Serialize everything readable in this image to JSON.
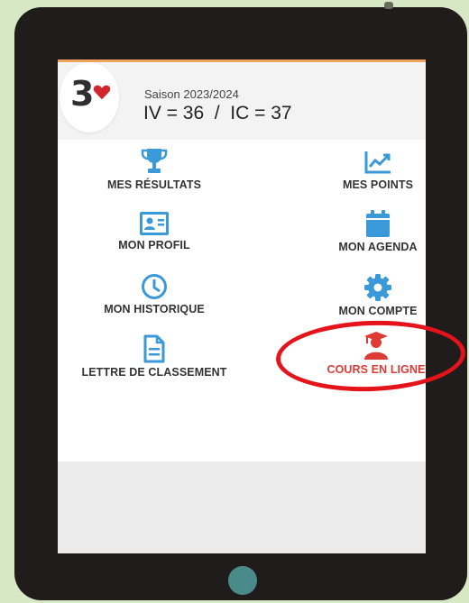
{
  "header": {
    "logo_number": "3",
    "season_label": "Saison 2023/2024",
    "stats": "IV = 36  /  IC = 37"
  },
  "menu": {
    "mes_resultats": "MES RÉSULTATS",
    "mes_points": "MES POINTS",
    "mon_profil": "MON PROFIL",
    "mon_agenda": "MON AGENDA",
    "mon_historique": "MON HISTORIQUE",
    "mon_compte": "MON COMPTE",
    "lettre_de_classement": "LETTRE DE CLASSEMENT",
    "cours_en_ligne": "COURS EN LIGNE"
  },
  "colors": {
    "icon_blue": "#3a9ad9",
    "highlight_red": "#e03a35",
    "accent_orange": "#f0a35c"
  },
  "icons": {
    "mes_resultats": "trophy-icon",
    "mes_points": "chart-line-icon",
    "mon_profil": "id-card-icon",
    "mon_agenda": "calendar-icon",
    "mon_historique": "clock-icon",
    "mon_compte": "gear-icon",
    "lettre_de_classement": "document-icon",
    "cours_en_ligne": "graduate-user-icon"
  }
}
